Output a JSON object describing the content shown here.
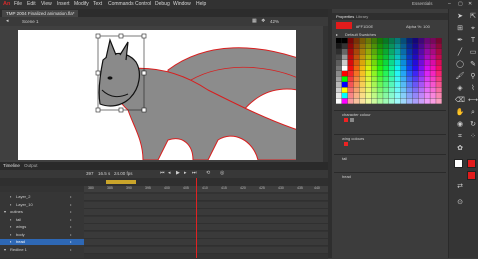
{
  "app": {
    "logo": "An",
    "essentials": "Essentials"
  },
  "menu": [
    "File",
    "Edit",
    "View",
    "Insert",
    "Modify",
    "Text",
    "Commands",
    "Control",
    "Debug",
    "Window",
    "Help"
  ],
  "doc_tab": "TMP 2004 Finalized animation.fla*",
  "scene": "Scene 1",
  "zoom": "42%",
  "properties": {
    "tabs": [
      "Properties",
      "Library"
    ],
    "hex": "#FF1D0E",
    "alpha": "Alpha %: 100",
    "swatch_group": "Default Swatches",
    "sections": [
      "character colour",
      "wing colours",
      "tail",
      "head"
    ]
  },
  "timeline": {
    "tabs": [
      "Timeline",
      "Output"
    ],
    "fps": "24.00 fps",
    "time": "16.5 s",
    "frame": "397",
    "ruler": [
      "380",
      "385",
      "390",
      "395",
      "400",
      "405",
      "410",
      "415",
      "420",
      "425",
      "430",
      "435",
      "440"
    ],
    "layers": [
      {
        "name": "Layer_2",
        "indent": 1,
        "selected": false
      },
      {
        "name": "Layer_10",
        "indent": 1,
        "selected": false
      },
      {
        "name": "outines",
        "indent": 0,
        "selected": false
      },
      {
        "name": "tail",
        "indent": 1,
        "selected": false
      },
      {
        "name": "wings",
        "indent": 1,
        "selected": false
      },
      {
        "name": "body",
        "indent": 1,
        "selected": false
      },
      {
        "name": "head",
        "indent": 1,
        "selected": true
      },
      {
        "name": "Redline 1",
        "indent": 0,
        "selected": false
      }
    ]
  },
  "colors": {
    "accent": "#d42a2a",
    "stage": "#ffffff",
    "selection": "#2e68b5",
    "body_fill": "#8a8a8a",
    "outline": "#d81e1e"
  }
}
